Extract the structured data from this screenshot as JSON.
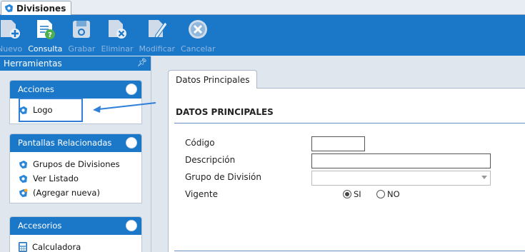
{
  "window": {
    "tab_title": "Divisiones"
  },
  "toolbar": {
    "nuevo": "Nuevo",
    "consulta": "Consulta",
    "grabar": "Grabar",
    "eliminar": "Eliminar",
    "modificar": "Modificar",
    "cancelar": "Cancelar",
    "accent": "#1b78c8"
  },
  "left_panel": {
    "title": "Herramientas",
    "groups": [
      {
        "title": "Acciones",
        "items": [
          "Logo"
        ]
      },
      {
        "title": "Pantallas Relacionadas",
        "items": [
          "Grupos de Divisiones",
          "Ver Listado",
          "(Agregar nueva)"
        ]
      },
      {
        "title": "Accesorios",
        "items": [
          "Calculadora"
        ]
      }
    ]
  },
  "main": {
    "tab": "Datos Principales",
    "section_title": "DATOS PRINCIPALES",
    "fields": {
      "codigo_label": "Código",
      "codigo_value": "",
      "descripcion_label": "Descripción",
      "descripcion_value": "",
      "grupo_label": "Grupo de División",
      "grupo_value": "",
      "vigente_label": "Vigente",
      "vigente_si": "SI",
      "vigente_no": "NO",
      "vigente_selected": "SI"
    }
  }
}
